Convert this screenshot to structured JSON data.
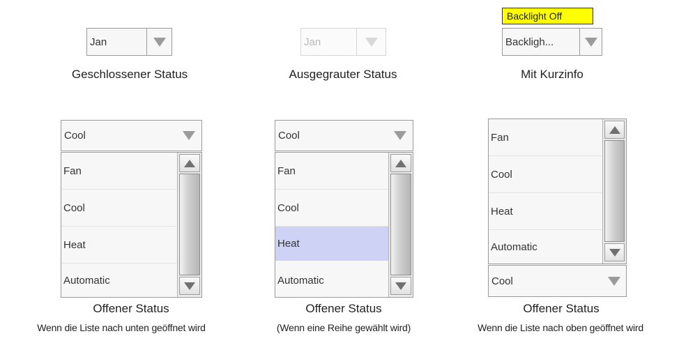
{
  "closed": {
    "value": "Jan",
    "caption": "Geschlossener Status"
  },
  "disabled": {
    "value": "Jan",
    "caption": "Ausgegrauter Status"
  },
  "tooltip": {
    "tip": "Backlight Off",
    "value": "Backligh...",
    "caption": "Mit Kurzinfo"
  },
  "open_down": {
    "value": "Cool",
    "items": [
      "Fan",
      "Cool",
      "Heat",
      "Automatic"
    ],
    "caption": "Offener Status",
    "subcaption": "Wenn die Liste nach unten geöffnet wird"
  },
  "open_selected": {
    "value": "Cool",
    "items": [
      "Fan",
      "Cool",
      "Heat",
      "Automatic"
    ],
    "selected": "Heat",
    "caption": "Offener Status",
    "subcaption": "(Wenn eine Reihe gewählt wird)"
  },
  "open_up": {
    "value": "Cool",
    "items": [
      "Fan",
      "Cool",
      "Heat",
      "Automatic"
    ],
    "caption": "Offener Status",
    "subcaption": "Wenn die Liste nach oben geöffnet wird"
  },
  "colors": {
    "selected_row": "#ced2f4",
    "tooltip_bg": "#ffff00",
    "border": "#9a9a9a"
  },
  "icons": [
    "dropdown-arrow-icon",
    "scroll-up-icon",
    "scroll-down-icon"
  ]
}
